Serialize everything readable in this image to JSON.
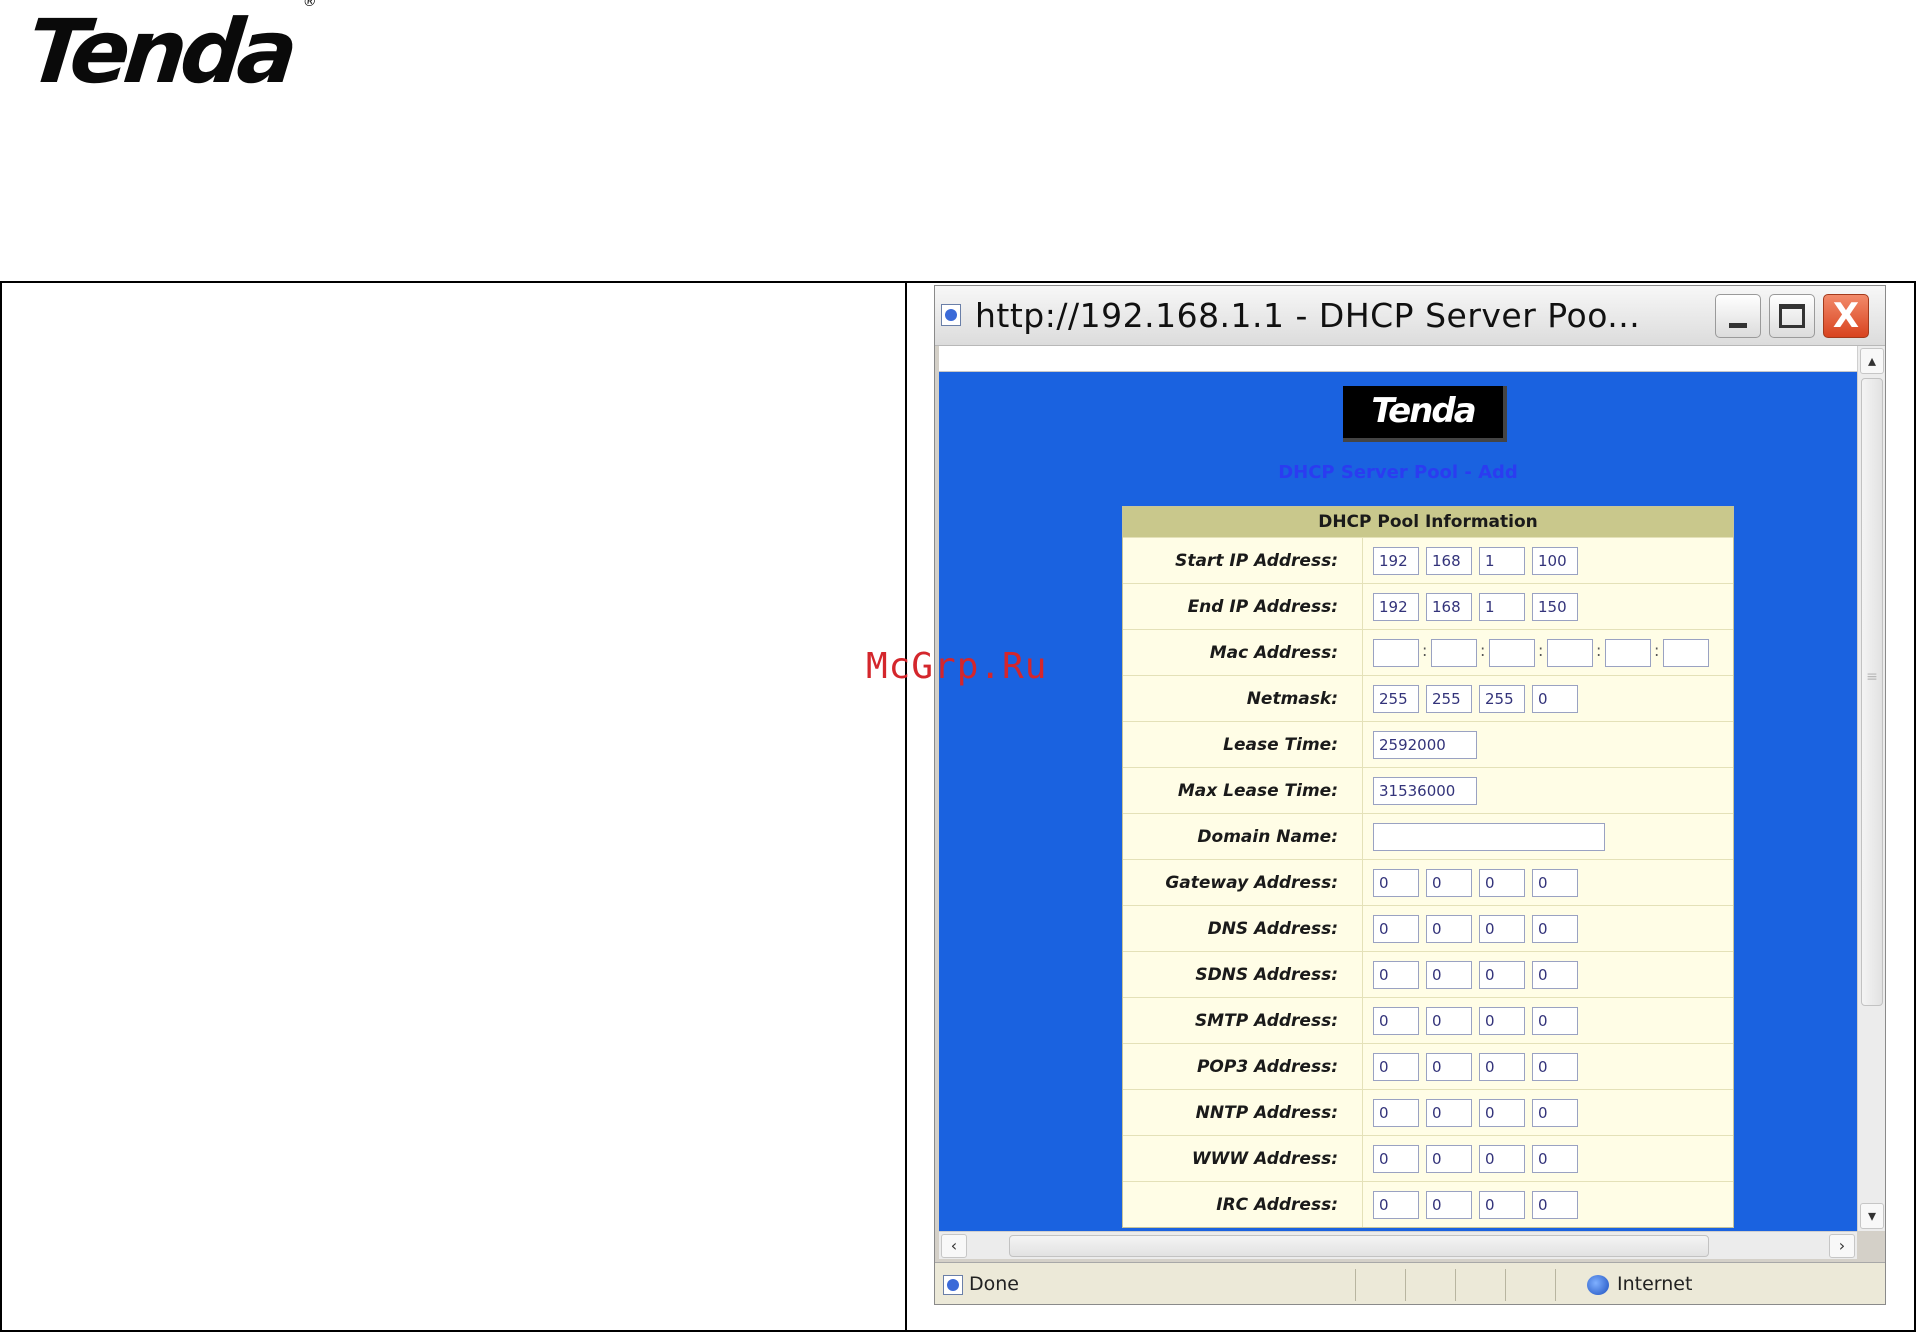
{
  "doc": {
    "logo": "Tenda",
    "logo_mark": "®",
    "watermark": "McGrp.Ru"
  },
  "window": {
    "title": "http://192.168.1.1 - DHCP Server Poo...",
    "buttons": {
      "minimize": "minimize",
      "maximize": "maximize",
      "close": "X"
    }
  },
  "page": {
    "logo": "Tenda",
    "heading": "DHCP Server Pool - Add",
    "panel_title": "DHCP Pool Information"
  },
  "fields": {
    "start_ip": {
      "label": "Start IP Address:",
      "octets": [
        "192",
        "168",
        "1",
        "100"
      ]
    },
    "end_ip": {
      "label": "End IP Address:",
      "octets": [
        "192",
        "168",
        "1",
        "150"
      ]
    },
    "mac": {
      "label": "Mac Address:",
      "parts": [
        "",
        "",
        "",
        "",
        "",
        ""
      ],
      "separator": ":"
    },
    "netmask": {
      "label": "Netmask:",
      "octets": [
        "255",
        "255",
        "255",
        "0"
      ]
    },
    "lease_time": {
      "label": "Lease Time:",
      "value": "2592000"
    },
    "max_lease_time": {
      "label": "Max Lease Time:",
      "value": "31536000"
    },
    "domain_name": {
      "label": "Domain Name:",
      "value": ""
    },
    "gateway": {
      "label": "Gateway Address:",
      "octets": [
        "0",
        "0",
        "0",
        "0"
      ]
    },
    "dns": {
      "label": "DNS Address:",
      "octets": [
        "0",
        "0",
        "0",
        "0"
      ]
    },
    "sdns": {
      "label": "SDNS Address:",
      "octets": [
        "0",
        "0",
        "0",
        "0"
      ]
    },
    "smtp": {
      "label": "SMTP Address:",
      "octets": [
        "0",
        "0",
        "0",
        "0"
      ]
    },
    "pop3": {
      "label": "POP3 Address:",
      "octets": [
        "0",
        "0",
        "0",
        "0"
      ]
    },
    "nntp": {
      "label": "NNTP Address:",
      "octets": [
        "0",
        "0",
        "0",
        "0"
      ]
    },
    "www": {
      "label": "WWW Address:",
      "octets": [
        "0",
        "0",
        "0",
        "0"
      ]
    },
    "irc": {
      "label": "IRC Address:",
      "octets": [
        "0",
        "0",
        "0",
        "0"
      ]
    }
  },
  "statusbar": {
    "status": "Done",
    "zone": "Internet"
  },
  "icons": {
    "page": "ie-page-icon",
    "zone": "internet-globe-icon",
    "scroll_up": "chevron-up-icon",
    "scroll_down": "chevron-down-icon",
    "scroll_left": "chevron-left-icon",
    "scroll_right": "chevron-right-icon"
  },
  "colors": {
    "page_background": "#1a62e0",
    "panel_background": "#fffde6",
    "panel_header": "#c9c88c",
    "heading_text": "#2b3cf0",
    "watermark": "#d4262c",
    "close_button": "#d8431f"
  }
}
